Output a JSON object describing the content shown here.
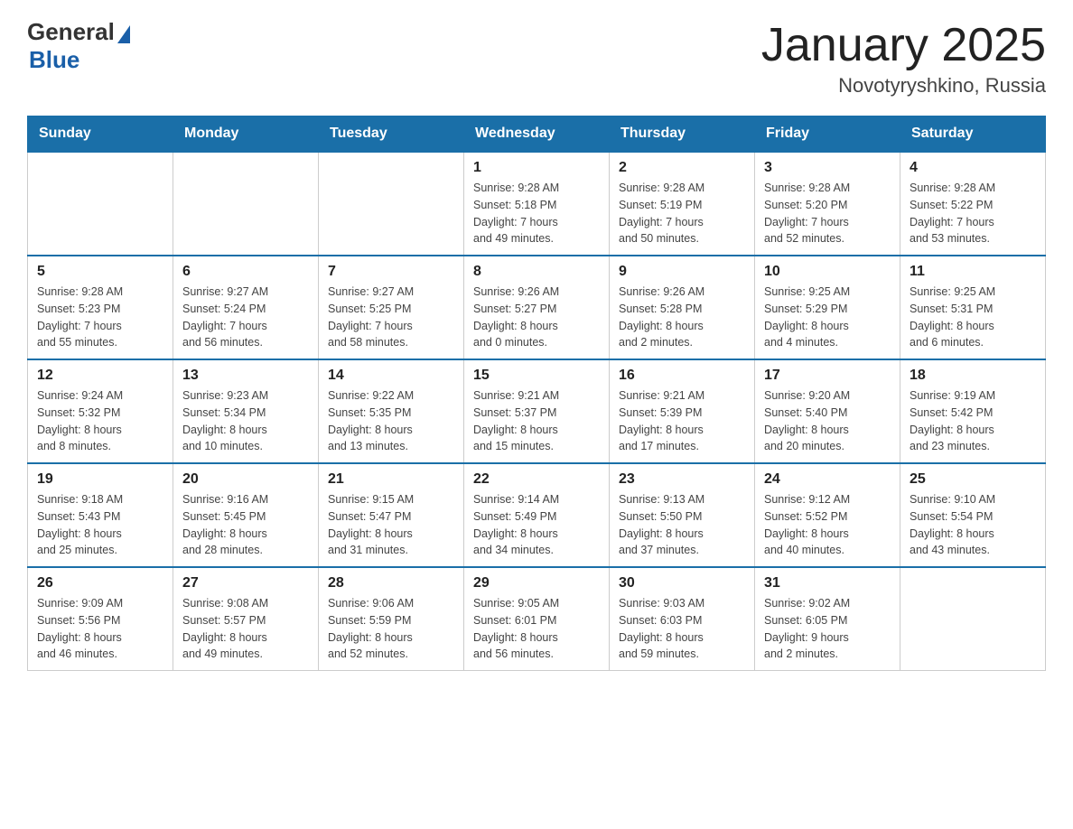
{
  "header": {
    "logo_general": "General",
    "logo_blue": "Blue",
    "title": "January 2025",
    "subtitle": "Novotyryshkino, Russia"
  },
  "days_of_week": [
    "Sunday",
    "Monday",
    "Tuesday",
    "Wednesday",
    "Thursday",
    "Friday",
    "Saturday"
  ],
  "weeks": [
    [
      {
        "day": "",
        "info": ""
      },
      {
        "day": "",
        "info": ""
      },
      {
        "day": "",
        "info": ""
      },
      {
        "day": "1",
        "info": "Sunrise: 9:28 AM\nSunset: 5:18 PM\nDaylight: 7 hours\nand 49 minutes."
      },
      {
        "day": "2",
        "info": "Sunrise: 9:28 AM\nSunset: 5:19 PM\nDaylight: 7 hours\nand 50 minutes."
      },
      {
        "day": "3",
        "info": "Sunrise: 9:28 AM\nSunset: 5:20 PM\nDaylight: 7 hours\nand 52 minutes."
      },
      {
        "day": "4",
        "info": "Sunrise: 9:28 AM\nSunset: 5:22 PM\nDaylight: 7 hours\nand 53 minutes."
      }
    ],
    [
      {
        "day": "5",
        "info": "Sunrise: 9:28 AM\nSunset: 5:23 PM\nDaylight: 7 hours\nand 55 minutes."
      },
      {
        "day": "6",
        "info": "Sunrise: 9:27 AM\nSunset: 5:24 PM\nDaylight: 7 hours\nand 56 minutes."
      },
      {
        "day": "7",
        "info": "Sunrise: 9:27 AM\nSunset: 5:25 PM\nDaylight: 7 hours\nand 58 minutes."
      },
      {
        "day": "8",
        "info": "Sunrise: 9:26 AM\nSunset: 5:27 PM\nDaylight: 8 hours\nand 0 minutes."
      },
      {
        "day": "9",
        "info": "Sunrise: 9:26 AM\nSunset: 5:28 PM\nDaylight: 8 hours\nand 2 minutes."
      },
      {
        "day": "10",
        "info": "Sunrise: 9:25 AM\nSunset: 5:29 PM\nDaylight: 8 hours\nand 4 minutes."
      },
      {
        "day": "11",
        "info": "Sunrise: 9:25 AM\nSunset: 5:31 PM\nDaylight: 8 hours\nand 6 minutes."
      }
    ],
    [
      {
        "day": "12",
        "info": "Sunrise: 9:24 AM\nSunset: 5:32 PM\nDaylight: 8 hours\nand 8 minutes."
      },
      {
        "day": "13",
        "info": "Sunrise: 9:23 AM\nSunset: 5:34 PM\nDaylight: 8 hours\nand 10 minutes."
      },
      {
        "day": "14",
        "info": "Sunrise: 9:22 AM\nSunset: 5:35 PM\nDaylight: 8 hours\nand 13 minutes."
      },
      {
        "day": "15",
        "info": "Sunrise: 9:21 AM\nSunset: 5:37 PM\nDaylight: 8 hours\nand 15 minutes."
      },
      {
        "day": "16",
        "info": "Sunrise: 9:21 AM\nSunset: 5:39 PM\nDaylight: 8 hours\nand 17 minutes."
      },
      {
        "day": "17",
        "info": "Sunrise: 9:20 AM\nSunset: 5:40 PM\nDaylight: 8 hours\nand 20 minutes."
      },
      {
        "day": "18",
        "info": "Sunrise: 9:19 AM\nSunset: 5:42 PM\nDaylight: 8 hours\nand 23 minutes."
      }
    ],
    [
      {
        "day": "19",
        "info": "Sunrise: 9:18 AM\nSunset: 5:43 PM\nDaylight: 8 hours\nand 25 minutes."
      },
      {
        "day": "20",
        "info": "Sunrise: 9:16 AM\nSunset: 5:45 PM\nDaylight: 8 hours\nand 28 minutes."
      },
      {
        "day": "21",
        "info": "Sunrise: 9:15 AM\nSunset: 5:47 PM\nDaylight: 8 hours\nand 31 minutes."
      },
      {
        "day": "22",
        "info": "Sunrise: 9:14 AM\nSunset: 5:49 PM\nDaylight: 8 hours\nand 34 minutes."
      },
      {
        "day": "23",
        "info": "Sunrise: 9:13 AM\nSunset: 5:50 PM\nDaylight: 8 hours\nand 37 minutes."
      },
      {
        "day": "24",
        "info": "Sunrise: 9:12 AM\nSunset: 5:52 PM\nDaylight: 8 hours\nand 40 minutes."
      },
      {
        "day": "25",
        "info": "Sunrise: 9:10 AM\nSunset: 5:54 PM\nDaylight: 8 hours\nand 43 minutes."
      }
    ],
    [
      {
        "day": "26",
        "info": "Sunrise: 9:09 AM\nSunset: 5:56 PM\nDaylight: 8 hours\nand 46 minutes."
      },
      {
        "day": "27",
        "info": "Sunrise: 9:08 AM\nSunset: 5:57 PM\nDaylight: 8 hours\nand 49 minutes."
      },
      {
        "day": "28",
        "info": "Sunrise: 9:06 AM\nSunset: 5:59 PM\nDaylight: 8 hours\nand 52 minutes."
      },
      {
        "day": "29",
        "info": "Sunrise: 9:05 AM\nSunset: 6:01 PM\nDaylight: 8 hours\nand 56 minutes."
      },
      {
        "day": "30",
        "info": "Sunrise: 9:03 AM\nSunset: 6:03 PM\nDaylight: 8 hours\nand 59 minutes."
      },
      {
        "day": "31",
        "info": "Sunrise: 9:02 AM\nSunset: 6:05 PM\nDaylight: 9 hours\nand 2 minutes."
      },
      {
        "day": "",
        "info": ""
      }
    ]
  ]
}
